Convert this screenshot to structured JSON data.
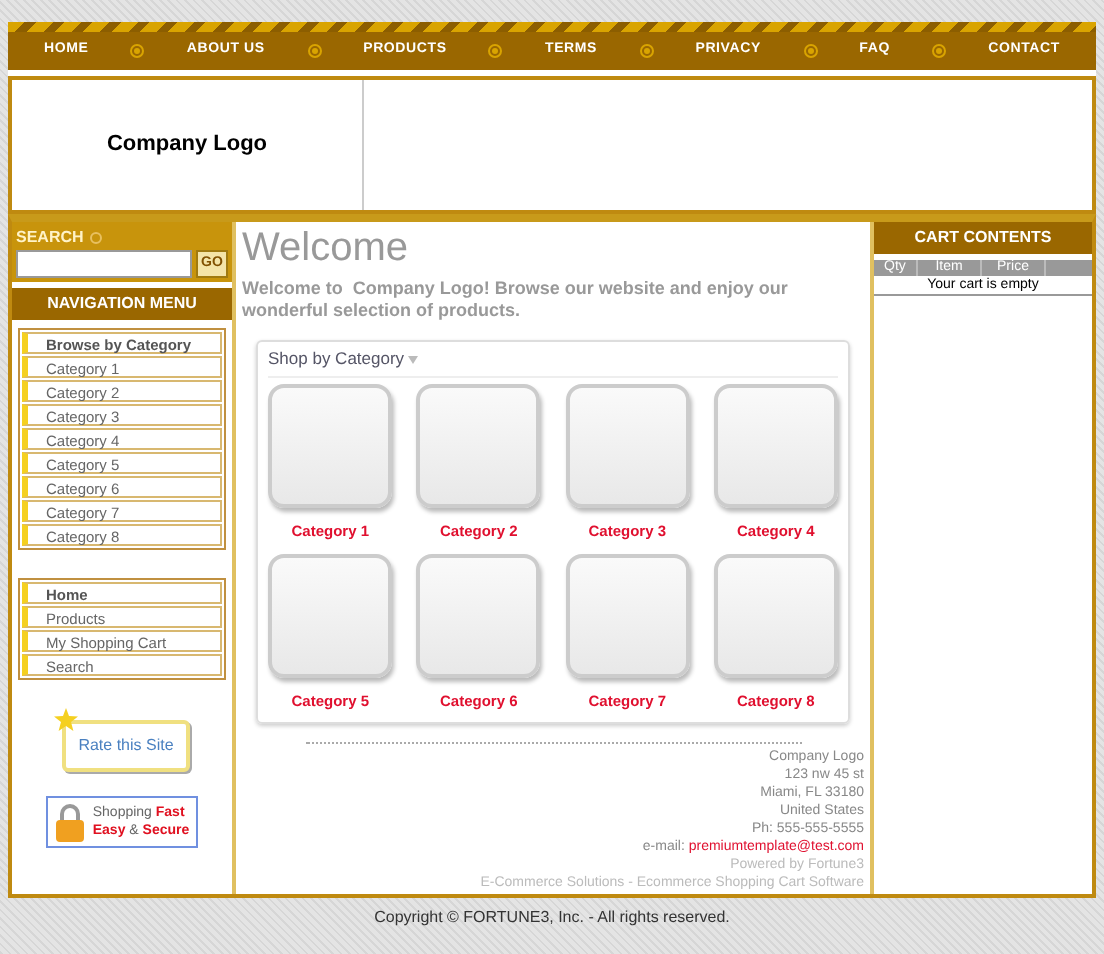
{
  "top_nav": [
    {
      "label": "HOME"
    },
    {
      "label": "ABOUT US"
    },
    {
      "label": "PRODUCTS"
    },
    {
      "label": "TERMS"
    },
    {
      "label": "PRIVACY"
    },
    {
      "label": "FAQ"
    },
    {
      "label": "CONTACT"
    }
  ],
  "header": {
    "logo": "Company Logo"
  },
  "search": {
    "title": "SEARCH",
    "button": "GO"
  },
  "navigation_menu": {
    "title": "NAVIGATION MENU",
    "groups": [
      {
        "items": [
          {
            "label": "Browse by Category",
            "kind": "heading"
          },
          {
            "label": "Category 1",
            "kind": "link"
          },
          {
            "label": "Category 2",
            "kind": "link"
          },
          {
            "label": "Category 3",
            "kind": "link"
          },
          {
            "label": "Category 4",
            "kind": "link"
          },
          {
            "label": "Category 5",
            "kind": "link"
          },
          {
            "label": "Category 6",
            "kind": "link"
          },
          {
            "label": "Category 7",
            "kind": "link"
          },
          {
            "label": "Category 8",
            "kind": "link"
          }
        ]
      },
      {
        "items": [
          {
            "label": "Home",
            "kind": "heading"
          },
          {
            "label": "Products",
            "kind": "link"
          },
          {
            "label": "My Shopping Cart",
            "kind": "link"
          },
          {
            "label": "Search",
            "kind": "link"
          }
        ]
      }
    ]
  },
  "rate_badge": {
    "label": "Rate this Site"
  },
  "secure_badge": {
    "lines": [
      "Shopping **Fast**",
      "**Easy** & **Secure**"
    ]
  },
  "main": {
    "title": "Welcome",
    "intro": "Welcome to  Company Logo! Browse our website and enjoy our wonderful selection of products.",
    "shop_panel": {
      "title": "Shop by Category",
      "categories": [
        {
          "label": "Category 1"
        },
        {
          "label": "Category 2"
        },
        {
          "label": "Category 3"
        },
        {
          "label": "Category 4"
        },
        {
          "label": "Category 5"
        },
        {
          "label": "Category 6"
        },
        {
          "label": "Category 7"
        },
        {
          "label": "Category 8"
        }
      ]
    },
    "address": [
      "Company Logo",
      "123 nw 45 st",
      "Miami, FL 33180",
      "United States",
      "Ph: 555-555-5555"
    ],
    "email": {
      "label": "e-mail: ",
      "address": "premiumtemplate@test.com"
    },
    "powered": "Powered by Fortune3",
    "tagline": "E-Commerce Solutions - Ecommerce Shopping Cart Software"
  },
  "cart": {
    "title": "CART CONTENTS",
    "columns": [
      "Qty",
      "Item",
      "Price"
    ],
    "empty_text": "Your cart is empty"
  },
  "copyright": "Copyright © FORTUNE3, Inc. - All rights reserved."
}
